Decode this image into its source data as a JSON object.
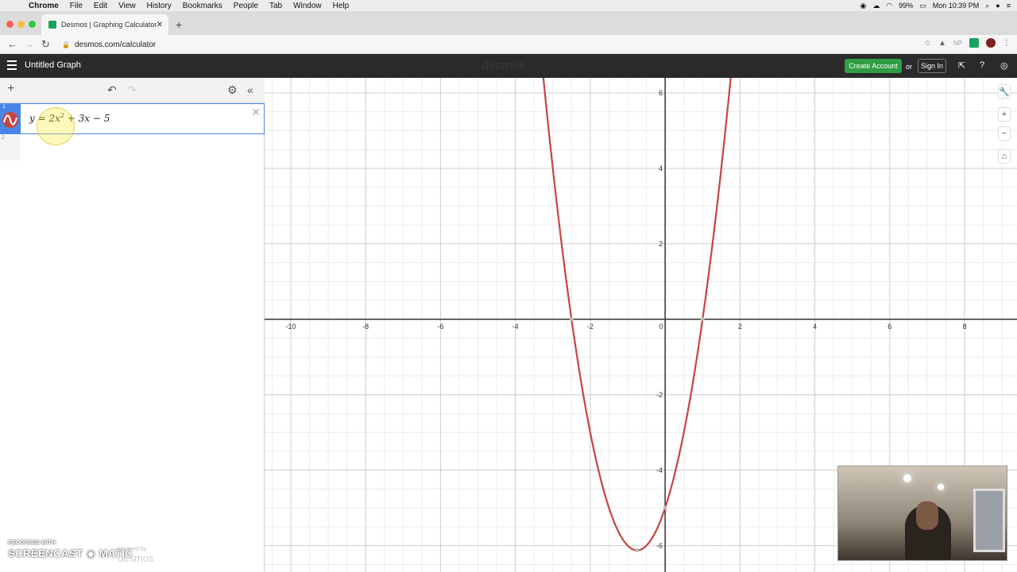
{
  "menubar": {
    "app": "Chrome",
    "items": [
      "File",
      "Edit",
      "View",
      "History",
      "Bookmarks",
      "People",
      "Tab",
      "Window",
      "Help"
    ],
    "battery": "99%",
    "clock": "Mon 10:39 PM"
  },
  "browser": {
    "tab_title": "Desmos | Graphing Calculator",
    "url": "desmos.com/calculator"
  },
  "header": {
    "graph_title": "Untitled Graph",
    "brand": "desmos",
    "create_account": "Create Account",
    "or": "or",
    "sign_in": "Sign In"
  },
  "expressions": [
    {
      "index": "1",
      "latex_display": "y = 2x² + 3x − 5",
      "color": "#c74440"
    }
  ],
  "expression_row2_index": "2",
  "colors": {
    "accent": "#4a86e8",
    "curve": "#c74440",
    "create_account_bg": "#2f9e44",
    "header_bg": "#2a2a2a"
  },
  "chart_data": {
    "type": "line",
    "function": "y = 2x^2 + 3x - 5",
    "xlim": [
      -10.7,
      9.4
    ],
    "ylim": [
      -6.7,
      6.4
    ],
    "x_ticks": [
      -10,
      -8,
      -6,
      -4,
      -2,
      0,
      2,
      4,
      6,
      8
    ],
    "y_ticks": [
      -6,
      -4,
      -2,
      2,
      4,
      6
    ],
    "grid": true,
    "series": [
      {
        "coef": [
          2,
          3,
          -5
        ],
        "color": "#c74440"
      }
    ],
    "points": [
      {
        "x": -2.5,
        "y": 0
      },
      {
        "x": 1,
        "y": 0
      },
      {
        "x": -0.75,
        "y": -6.125
      },
      {
        "x": 0,
        "y": -5
      }
    ]
  },
  "watermark": {
    "line1": "RECORDED WITH",
    "line2": "SCREENCAST ◉ MATIC",
    "powered_by": "powered by",
    "powered_brand": "desmos"
  }
}
